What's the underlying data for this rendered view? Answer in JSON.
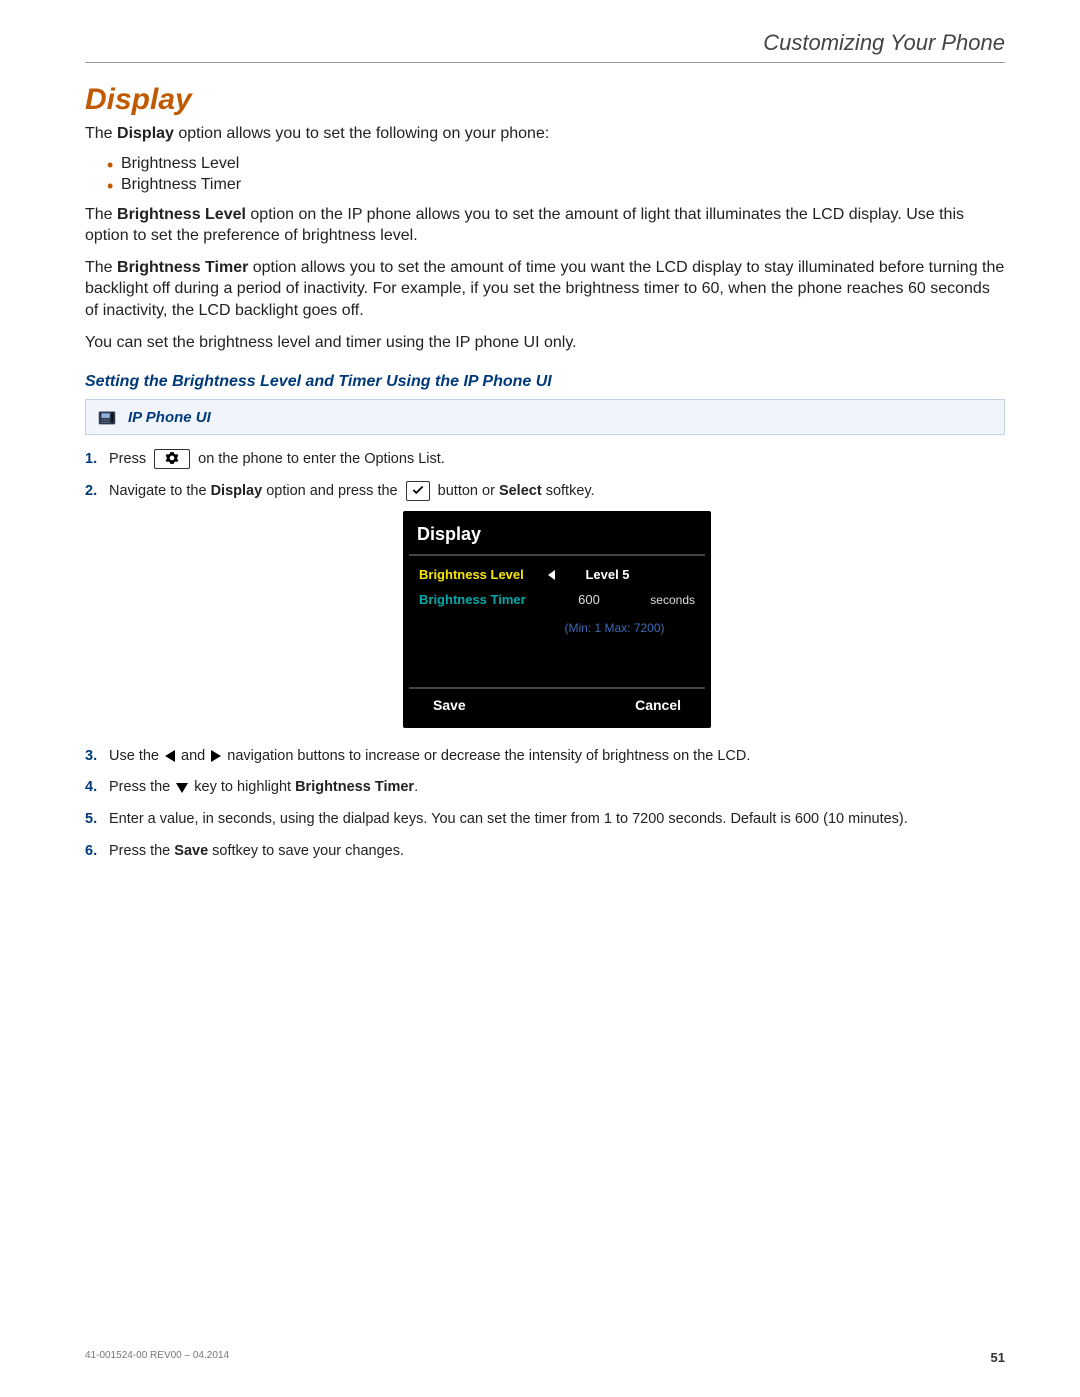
{
  "chapter": "Customizing Your Phone",
  "section_title": "Display",
  "intro_prefix": "The ",
  "intro_bold": "Display",
  "intro_suffix": " option allows you to set the following on your phone:",
  "bullets": {
    "a": "Brightness Level",
    "b": "Brightness Timer"
  },
  "para2_prefix": "The ",
  "para2_bold": "Brightness Level",
  "para2_suffix": " option on the IP phone allows you to set the amount of light that illuminates the LCD display. Use this option to set the preference of brightness level.",
  "para3_prefix": "The ",
  "para3_bold": "Brightness Timer",
  "para3_suffix": " option allows you to set the amount of time you want the LCD display to stay illuminated before turning the backlight off during a period of inactivity. For example, if you set the brightness timer to 60, when the phone reaches 60 seconds of inactivity, the LCD backlight goes off.",
  "para4": "You can set the brightness level and timer using the IP phone UI only.",
  "sub_heading": "Setting the Brightness Level and Timer Using the IP Phone UI",
  "callout_label": "IP Phone UI",
  "steps": {
    "s1a": "Press",
    "s1b": "on the phone to enter the Options List.",
    "s2a": "Navigate to the ",
    "s2b": "Display",
    "s2c": " option and press the ",
    "s2d": " button or ",
    "s2e": "Select",
    "s2f": " softkey.",
    "s3a": "Use the ",
    "s3b": " and ",
    "s3c": " navigation buttons to increase or decrease the intensity of brightness on the LCD.",
    "s4a": "Press the ",
    "s4b": " key to highlight ",
    "s4c": "Brightness Timer",
    "s4d": ".",
    "s5": "Enter a value, in seconds, using the dialpad keys. You can set the timer from 1 to 7200 seconds. Default is 600 (10 minutes).",
    "s6a": "Press the ",
    "s6b": "Save",
    "s6c": " softkey to save your changes."
  },
  "lcd": {
    "title": "Display",
    "row1_label": "Brightness Level",
    "row1_value": "Level 5",
    "row2_label": "Brightness Timer",
    "row2_value": "600",
    "row2_unit": "seconds",
    "hint": "(Min: 1 Max: 7200)",
    "soft_left": "Save",
    "soft_right": "Cancel"
  },
  "footer_doc": "41-001524-00 REV00 – 04.2014",
  "page_number": "51"
}
